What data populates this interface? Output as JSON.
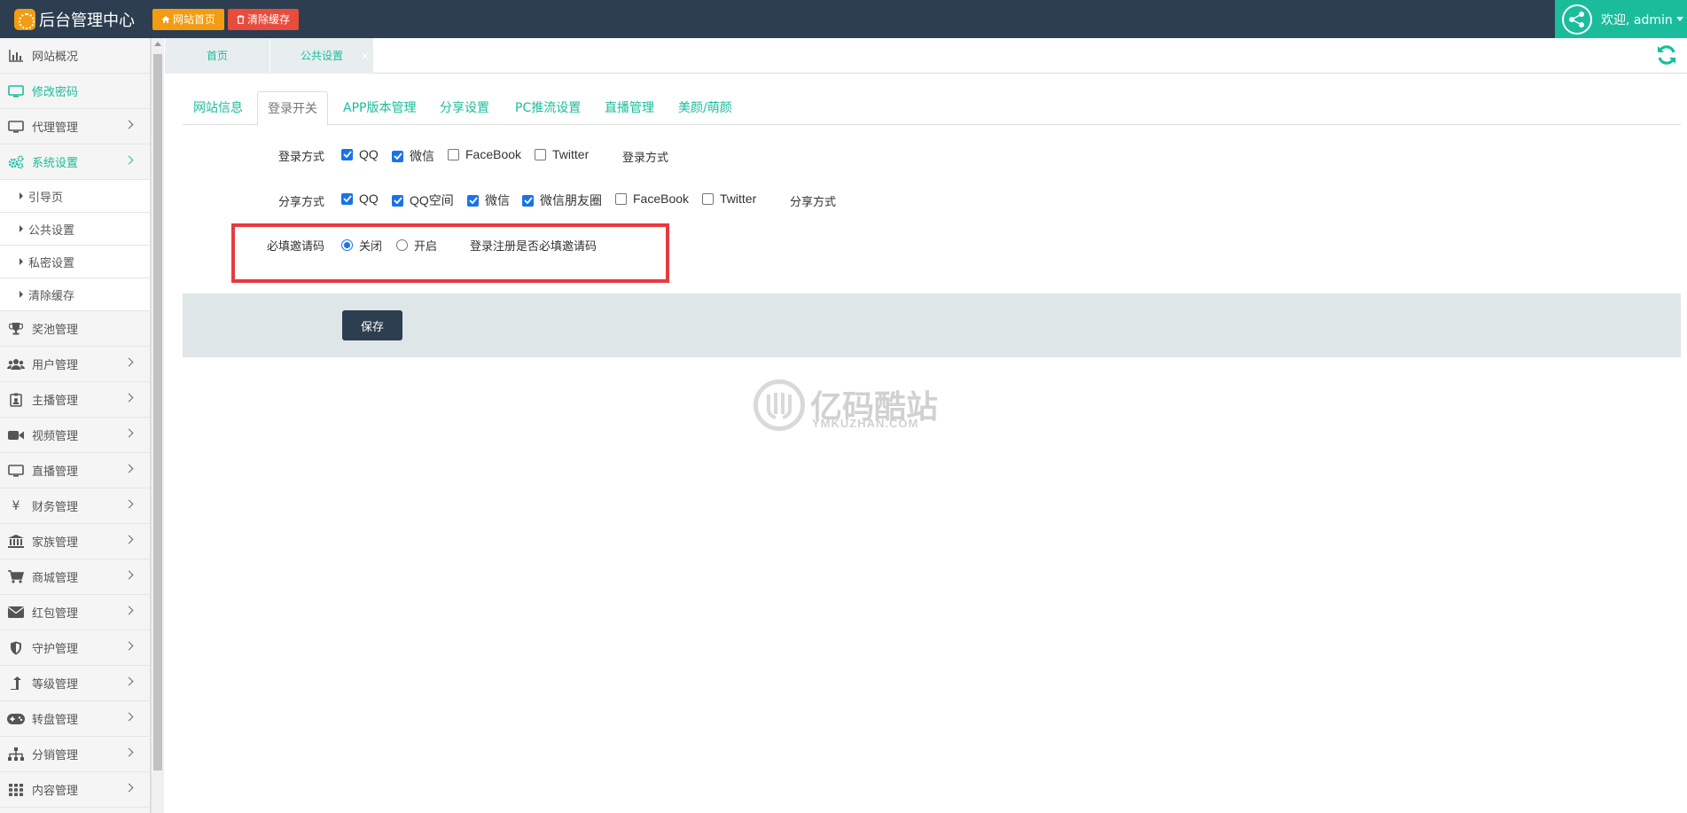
{
  "header": {
    "title": "后台管理中心",
    "home_button": "网站首页",
    "clear_cache_button": "清除缓存",
    "welcome": "欢迎, admin"
  },
  "sidebar": {
    "items": [
      {
        "label": "网站概况",
        "icon": "bar-chart-icon"
      },
      {
        "label": "修改密码",
        "icon": "monitor-icon"
      },
      {
        "label": "代理管理",
        "icon": "monitor-icon"
      },
      {
        "label": "系统设置",
        "icon": "gears-icon"
      }
    ],
    "sub_items": [
      "引导页",
      "公共设置",
      "私密设置",
      "清除缓存"
    ],
    "items_after": [
      {
        "label": "奖池管理",
        "icon": "trophy-icon"
      },
      {
        "label": "用户管理",
        "icon": "users-icon"
      },
      {
        "label": "主播管理",
        "icon": "badge-icon"
      },
      {
        "label": "视频管理",
        "icon": "video-icon"
      },
      {
        "label": "直播管理",
        "icon": "monitor-icon"
      },
      {
        "label": "财务管理",
        "icon": "yen-icon"
      },
      {
        "label": "家族管理",
        "icon": "bank-icon"
      },
      {
        "label": "商城管理",
        "icon": "cart-icon"
      },
      {
        "label": "红包管理",
        "icon": "envelope-icon"
      },
      {
        "label": "守护管理",
        "icon": "shield-icon"
      },
      {
        "label": "等级管理",
        "icon": "level-up-icon"
      },
      {
        "label": "转盘管理",
        "icon": "gamepad-icon"
      },
      {
        "label": "分销管理",
        "icon": "sitemap-icon"
      },
      {
        "label": "内容管理",
        "icon": "grid-icon"
      }
    ]
  },
  "page_tabs": {
    "home": "首页",
    "current": "公共设置",
    "close": "×"
  },
  "content_tabs": [
    "网站信息",
    "登录开关",
    "APP版本管理",
    "分享设置",
    "PC推流设置",
    "直播管理",
    "美颜/萌颜"
  ],
  "form": {
    "login": {
      "label": "登录方式",
      "options": [
        {
          "label": "QQ",
          "checked": true
        },
        {
          "label": "微信",
          "checked": true
        },
        {
          "label": "FaceBook",
          "checked": false
        },
        {
          "label": "Twitter",
          "checked": false
        }
      ],
      "hint": "登录方式"
    },
    "share": {
      "label": "分享方式",
      "options": [
        {
          "label": "QQ",
          "checked": true
        },
        {
          "label": "QQ空间",
          "checked": true
        },
        {
          "label": "微信",
          "checked": true
        },
        {
          "label": "微信朋友圈",
          "checked": true
        },
        {
          "label": "FaceBook",
          "checked": false
        },
        {
          "label": "Twitter",
          "checked": false
        }
      ],
      "hint": "分享方式"
    },
    "invite": {
      "label": "必填邀请码",
      "options": [
        {
          "label": "关闭",
          "selected": true
        },
        {
          "label": "开启",
          "selected": false
        }
      ],
      "hint": "登录注册是否必填邀请码"
    },
    "save_label": "保存"
  },
  "watermark": {
    "text": "亿码酷站",
    "sub": "YMKUZHAN.COM"
  },
  "colors": {
    "header_bg": "#2c3e50",
    "accent": "#1abc9c",
    "home_btn": "#f39c12",
    "cache_btn": "#e74c3c",
    "highlight_box": "#e8393d"
  }
}
